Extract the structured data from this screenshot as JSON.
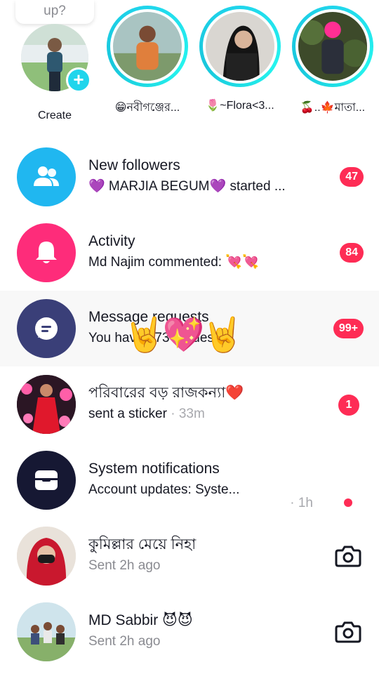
{
  "stories": {
    "bubble_text": "up?",
    "items": [
      {
        "label": "Create"
      },
      {
        "label": "😁নবীগঞ্জের..."
      },
      {
        "label": "🌷~Flora<3..."
      },
      {
        "label": "🍒..🍁মাতা..."
      }
    ]
  },
  "rows": [
    {
      "title": "New followers",
      "subtitle": "💜 MARJIA BEGUM💜 started ...",
      "badge": "47"
    },
    {
      "title": "Activity",
      "subtitle": "Md Najim commented: 💘💘",
      "badge": "84"
    },
    {
      "title": "Message requests",
      "subtitle": "You have 173 requests",
      "badge": "99+",
      "overlay": "🤘💖🤘"
    },
    {
      "title": "পরিবারের বড় রাজকন্যা❤️",
      "subtitle": "sent a sticker",
      "time": "· 33m",
      "badge": "1"
    },
    {
      "title": "System notifications",
      "subtitle": "Account updates: Syste...",
      "time": "· 1h"
    },
    {
      "title": "কুমিল্লার মেয়ে নিহা",
      "subtitle": "Sent 2h ago"
    },
    {
      "title": "MD Sabbir 😈😈",
      "subtitle": "Sent 2h ago"
    }
  ],
  "colors": {
    "followers_icon_bg": "#20b7f0",
    "activity_icon_bg": "#fe2c7a",
    "requests_icon_bg": "#3a3f78",
    "system_icon_bg": "#161833",
    "badge": "#fe2c55",
    "story_ring": "#20d5ec"
  }
}
